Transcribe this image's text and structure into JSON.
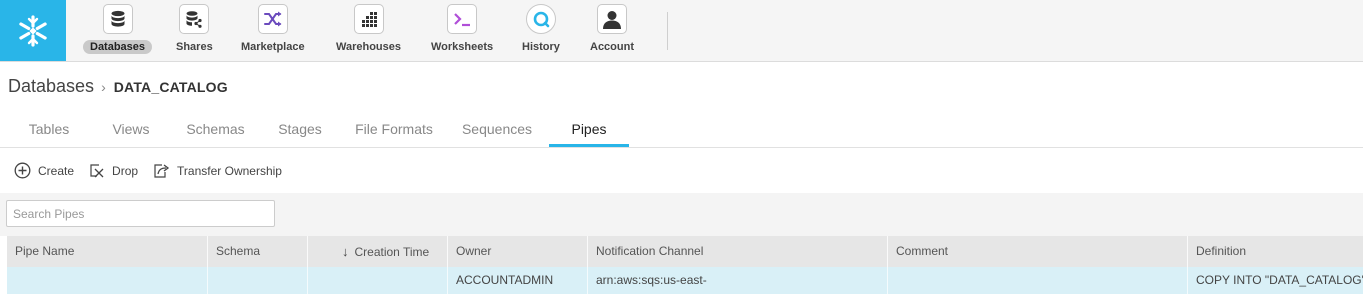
{
  "nav": {
    "items": [
      {
        "label": "Databases",
        "icon": "database-icon",
        "active": true
      },
      {
        "label": "Shares",
        "icon": "share-icon"
      },
      {
        "label": "Marketplace",
        "icon": "shuffle-icon"
      },
      {
        "label": "Warehouses",
        "icon": "warehouse-icon"
      },
      {
        "label": "Worksheets",
        "icon": "terminal-icon"
      },
      {
        "label": "History",
        "icon": "history-icon"
      },
      {
        "label": "Account",
        "icon": "user-icon"
      }
    ],
    "accent_color": "#29b5e8"
  },
  "breadcrumb": {
    "root": "Databases",
    "current": "DATA_CATALOG"
  },
  "tabs": [
    {
      "label": "Tables"
    },
    {
      "label": "Views"
    },
    {
      "label": "Schemas"
    },
    {
      "label": "Stages"
    },
    {
      "label": "File Formats"
    },
    {
      "label": "Sequences"
    },
    {
      "label": "Pipes",
      "active": true
    }
  ],
  "toolbar": {
    "create_label": "Create",
    "drop_label": "Drop",
    "transfer_label": "Transfer Ownership"
  },
  "search": {
    "placeholder": "Search Pipes",
    "value": ""
  },
  "table": {
    "columns": [
      "Pipe Name",
      "Schema",
      "Creation Time",
      "Owner",
      "Notification Channel",
      "Comment",
      "Definition"
    ],
    "sort_column": "Creation Time",
    "sort_direction": "descending",
    "rows": [
      [
        "",
        "",
        "",
        "ACCOUNTADMIN",
        "arn:aws:sqs:us-east-",
        "",
        "COPY INTO \"DATA_CATALOG\""
      ]
    ]
  }
}
